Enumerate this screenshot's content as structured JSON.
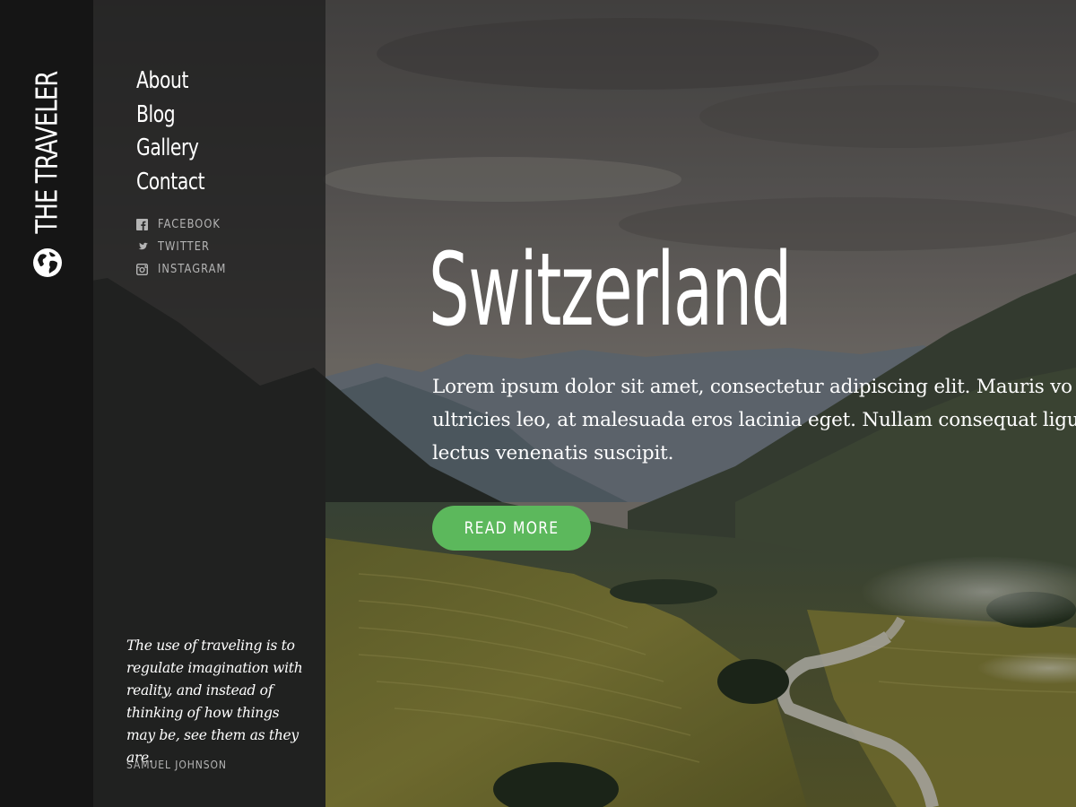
{
  "brand": {
    "name": "THE TRAVELER",
    "logo_icon": "globe-icon"
  },
  "nav": {
    "items": [
      {
        "label": "About"
      },
      {
        "label": "Blog"
      },
      {
        "label": "Gallery"
      },
      {
        "label": "Contact"
      }
    ]
  },
  "social": {
    "items": [
      {
        "label": "FACEBOOK",
        "icon": "facebook-icon"
      },
      {
        "label": "TWITTER",
        "icon": "twitter-icon"
      },
      {
        "label": "INSTAGRAM",
        "icon": "instagram-icon"
      }
    ]
  },
  "quote": {
    "text": "The use of traveling is to regulate imagination with reality, and instead of thinking of how things may be, see them as they are.",
    "author": "SAMUEL JOHNSON"
  },
  "hero": {
    "title": "Switzerland",
    "body_lines": [
      "Lorem ipsum dolor sit amet, consectetur adipiscing elit. Mauris vo",
      "ultricies leo, at malesuada eros lacinia eget. Nullam consequat ligu",
      "lectus venenatis suscipit."
    ],
    "cta_label": "READ MORE"
  },
  "colors": {
    "accent": "#5cb85c",
    "strip": "#151515",
    "panel": "#202020"
  }
}
